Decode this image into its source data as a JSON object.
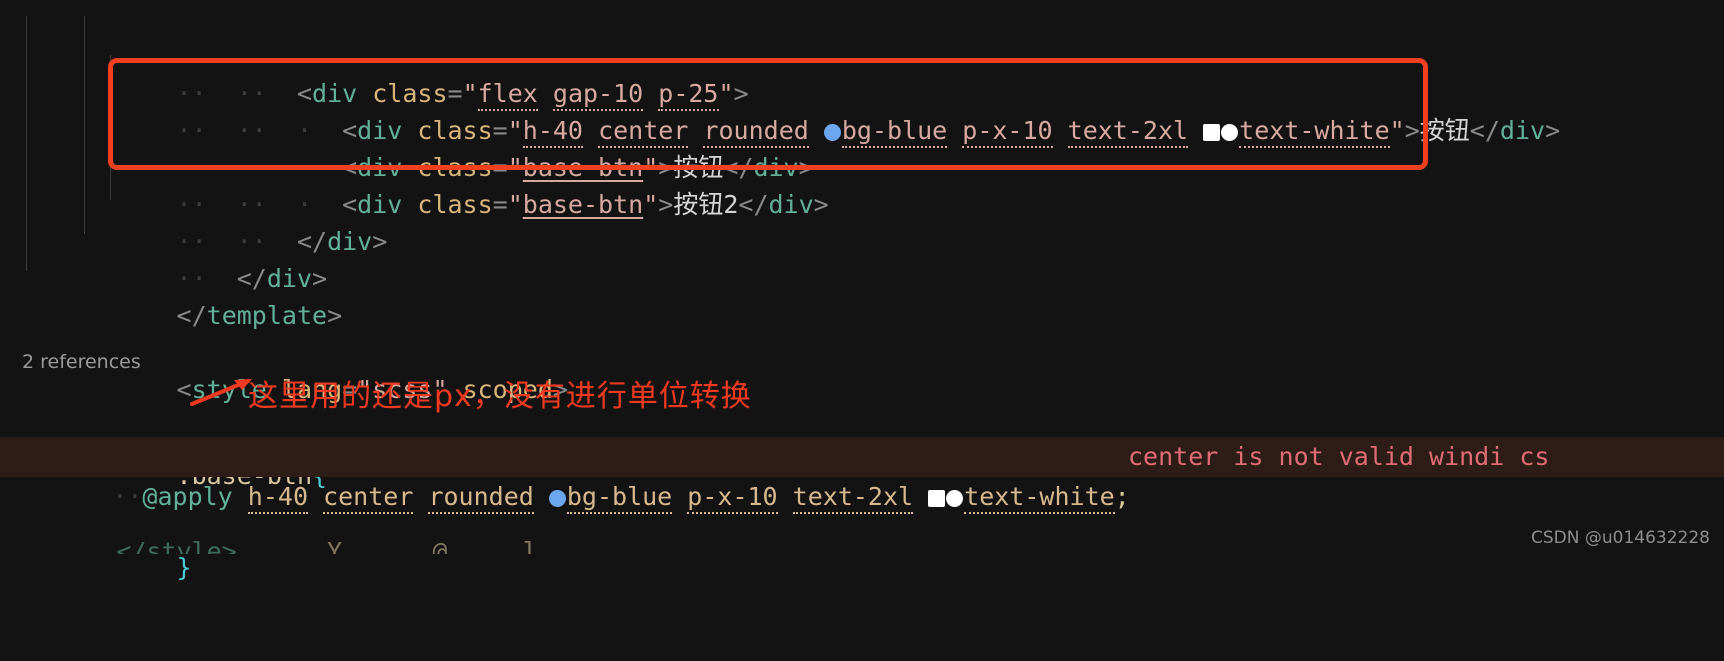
{
  "editor": {
    "background": "#131313",
    "lines": [
      {
        "id": "l1",
        "indent_dots": "··  ··",
        "content": "<div class=\"flex gap-10 p-25\">"
      },
      {
        "id": "l2",
        "indent_dots": "··  ··  ·",
        "content": "<div class=\"h-40 center rounded bg-blue p-x-10 text-2xl text-white\">按钮</div>"
      },
      {
        "id": "l3",
        "indent_dots": "··  ··  ·",
        "content": "<div class=\"base-btn\">按钮</div>"
      },
      {
        "id": "l4",
        "indent_dots": "··  ··  ·",
        "content": "<div class=\"base-btn\">按钮2</div>"
      },
      {
        "id": "l5",
        "indent_dots": "··  ··",
        "content": "</div>"
      },
      {
        "id": "l6",
        "indent_dots": "··",
        "content": "</div>"
      },
      {
        "id": "l7",
        "indent_dots": "",
        "content": "</template>"
      },
      {
        "id": "l8",
        "indent_dots": "",
        "content": ""
      },
      {
        "id": "l9",
        "indent_dots": "",
        "content": "<style lang=\"scss\" scoped>"
      },
      {
        "id": "l10",
        "indent_dots": "",
        "content": ".base-btn{"
      },
      {
        "id": "l11",
        "indent_dots": "··",
        "content": "@apply h-40 center rounded bg-blue p-x-10 text-2xl text-white;"
      },
      {
        "id": "l12",
        "indent_dots": "",
        "content": "}"
      }
    ],
    "tokens": {
      "tag_open_lt": "<",
      "tag_div": "div",
      "tag_close_gt": ">",
      "attr_class": "class",
      "equals": "=",
      "quote": "\"",
      "slash": "/",
      "template_tag": "template",
      "style_tag": "style",
      "attr_lang": "lang",
      "value_scss": "scss",
      "attr_scoped": "scoped",
      "selector_base_btn": ".base-btn",
      "brace_open": "{",
      "brace_close": "}",
      "at_apply": "@apply",
      "semicolon": ";"
    },
    "utilities_line1": [
      "flex",
      "gap-10",
      "p-25"
    ],
    "utilities_button": [
      "h-40",
      "center",
      "rounded",
      "bg-blue",
      "p-x-10",
      "text-2xl",
      "text-white"
    ],
    "class_base_btn": "base-btn",
    "button_text_1": "按钮",
    "button_text_2": "按钮",
    "button_text_3": "按钮2",
    "swatches": {
      "bg_blue": "#6ba6ef",
      "text_white_square": "#ffffff",
      "text_white_circle": "#ffffff"
    }
  },
  "codelens": {
    "label": "2 references"
  },
  "diagnostics": {
    "inline_error": "center is not valid windi cs",
    "error_line_background": "#2e1c16",
    "error_text_color": "#e06c75"
  },
  "annotation": {
    "text": "这里用的还是px，没有进行单位转换",
    "color": "#ef3a21",
    "arrow_color": "#ef3a21",
    "highlight_box_color": "#f04020"
  },
  "watermark": {
    "text": "CSDN @u014632228"
  }
}
